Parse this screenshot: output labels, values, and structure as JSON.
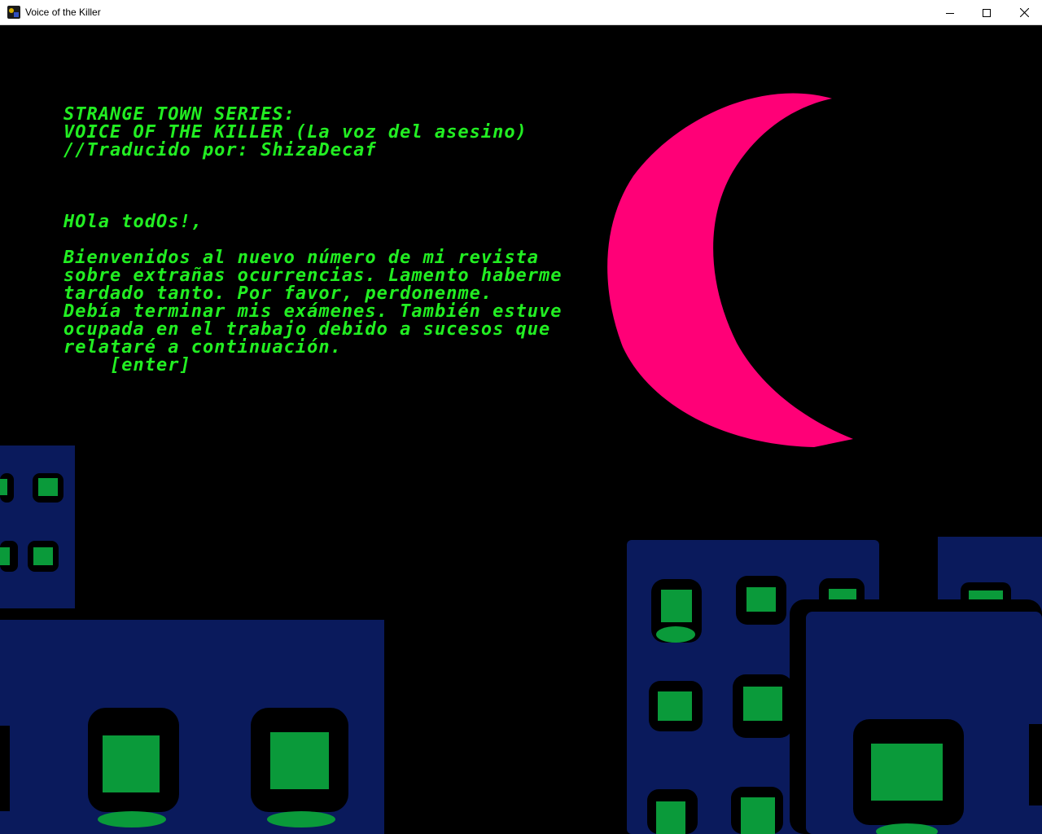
{
  "window": {
    "title": "Voice of the Killer",
    "icon": "game-app-icon",
    "controls": {
      "minimize_icon": "minimize-icon",
      "maximize_icon": "maximize-icon",
      "close_icon": "close-icon"
    }
  },
  "game": {
    "title_lines": [
      "STRANGE TOWN SERIES:",
      "VOICE OF THE KILLER (La voz del asesino)",
      "//Traducido por: ShizaDecaf"
    ],
    "greeting": "HOla todOs!,",
    "body_lines": [
      "Bienvenidos al nuevo número de mi revista",
      "sobre extrañas ocurrencias. Lamento haberme",
      "tardado tanto. Por favor, perdonenme.",
      "Debía terminar mis exámenes. También estuve",
      "ocupada en el trabajo debido a sucesos que",
      "relataré a continuación."
    ],
    "prompt": "[enter]"
  },
  "colors": {
    "background": "#000000",
    "text": "#22ee22",
    "moon": "#ff0077",
    "building": "#0a1a5c",
    "window_frame": "#000000",
    "window_glass": "#0a9a3a"
  }
}
